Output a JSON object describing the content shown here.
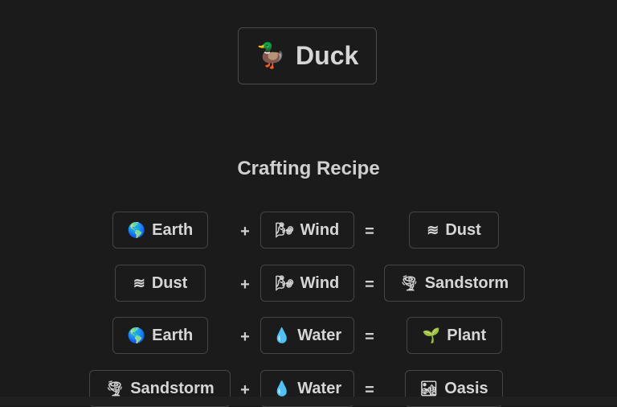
{
  "result": {
    "name": "Duck",
    "icon": "duck-icon"
  },
  "section_title": "Crafting Recipe",
  "operators": {
    "plus": "+",
    "equals": "="
  },
  "recipes": [
    {
      "a": {
        "name": "Earth",
        "icon": "earth-globe-icon"
      },
      "b": {
        "name": "Wind",
        "icon": "wind-icon"
      },
      "out": {
        "name": "Dust",
        "icon": "wavy-lines-icon"
      }
    },
    {
      "a": {
        "name": "Dust",
        "icon": "wavy-lines-icon"
      },
      "b": {
        "name": "Wind",
        "icon": "wind-icon"
      },
      "out": {
        "name": "Sandstorm",
        "icon": "tornado-icon"
      }
    },
    {
      "a": {
        "name": "Earth",
        "icon": "earth-globe-icon"
      },
      "b": {
        "name": "Water",
        "icon": "water-drop-icon"
      },
      "out": {
        "name": "Plant",
        "icon": "seedling-icon"
      }
    },
    {
      "a": {
        "name": "Sandstorm",
        "icon": "tornado-icon"
      },
      "b": {
        "name": "Water",
        "icon": "water-drop-icon"
      },
      "out": {
        "name": "Oasis",
        "icon": "desert-oasis-icon"
      }
    }
  ]
}
